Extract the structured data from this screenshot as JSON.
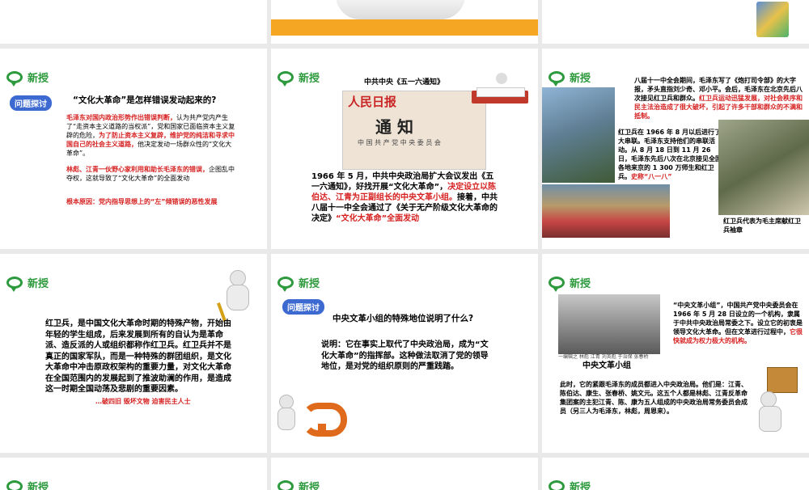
{
  "section_tag": "新授",
  "slides": {
    "s4": {
      "badge": "问题探讨",
      "question": "“文化大革命”是怎样错误发动起来的?",
      "p1_red": "毛泽东对国内政治形势作出错误判断，",
      "p1_black": "认为共产党内产生了“走资本主义道路的当权派”，党和国家已面临资本主义复辟的危险，",
      "p1_red2": "为了防止资本主义复辟，维护党的纯洁和寻求中国自己的社会主义道路，",
      "p1_black2": "他决定发动一场群众性的“文化大革命”。",
      "p2_red": "林彪、江青一伙野心家利用和助长毛泽东的错误，",
      "p2_black": "企图乱中夺权，这就导致了“文化大革命”的全面发动",
      "p3": "根本原因：党内指导思想上的“左”倾错误的恶性发展"
    },
    "s5": {
      "title": "中共中央《五一六通知》",
      "newspaper_head": "人民日报",
      "notice_title": "通 知",
      "notice_sub": "中 国 共 产 党 中 央 委 员 会",
      "text_black": "1966 年 5 月，中共中央政治局扩大会议发出《五一六通知》，好找开展“文化大革命”，",
      "text_red": "决定设立以陈伯达、江青为正副组长的中央文革小组。",
      "text_black2": "接着，中共八届十一中全会通过了《关于无产阶级文化大革命的决定》",
      "text_red2": "“文化大革命”全面发动"
    },
    "s6": {
      "top_text": "八届十一中全会期间，毛泽东写了《炮打司令部》的大字报，矛头直指刘少奇、邓小平。会后，毛泽东在北京先后八次接见红卫兵和群众。",
      "top_red": "红卫兵运动迅猛发展，对社会秩序和民主法治造成了很大破坏，引起了许多干部和群众的不满和抵制。",
      "mid_text": "红卫兵在 1966 年 8 月以后进行了大串联。毛泽东支持他们的串联活动。从 8 月 18 日到 11 月 26 日，毛泽东先后八次在北京接见全国各地来京的 1 300 万师生和红卫兵。",
      "mid_red": "史称“八一八”",
      "caption": "红卫兵代表为毛主席献红卫兵袖章"
    },
    "s7": {
      "body": "红卫兵，是中国文化大革命时期的特殊产物，开始由年轻的学生组成，后来发展到所有的自认为是革命派、造反派的人或组织都称作红卫兵。红卫兵并不是真正的国家军队，而是一种特殊的群团组织，是文化大革命中冲击原政权架构的重要力量，对文化大革命在全国范围内的发展起到了推波助澜的作用，是造成这一时期全国动荡及悲剧的重要因素。",
      "red": "…破四旧 毁坏文物 迫害民主人士"
    },
    "s8": {
      "badge": "问题探讨",
      "question": "中央文革小组的特殊地位说明了什么?",
      "answer": "说明：它在事实上取代了中央政治局，成为“文化大革命”的指挥部。这种做法取消了党的领导地位，是对党的组织原则的严重践踏。"
    },
    "s9": {
      "photo_caption": "一编辑之 林彪 江青 刘英彪 于治保 张春桥",
      "photo_title": "中央文革小组",
      "right_text": "“中央文革小组”，中国共产党中央委员会在 1966 年 5 月 28 日设立的一个机构，隶属于中共中央政治局常委之下。设立它的初衷是领导文化大革命。但在文革进行过程中，",
      "right_red": "它很快就成为权力极大的机构。",
      "bottom": "此时，它的紧跟毛泽东的成员都进入中央政治局。他们是：江青、陈伯达、康生、张春桥、姚文元。这五个人都是林彪、江青反革命集团案的主犯江青、陈、康为五人组成的中央政治局常务委员会成员（另三人为毛泽东，林彪，周恩来）。"
    }
  },
  "colors": {
    "accent_green": "#2e9a3e",
    "red_text": "#d62020",
    "orange": "#f5a623",
    "badge_blue": "#3d6ad1"
  }
}
